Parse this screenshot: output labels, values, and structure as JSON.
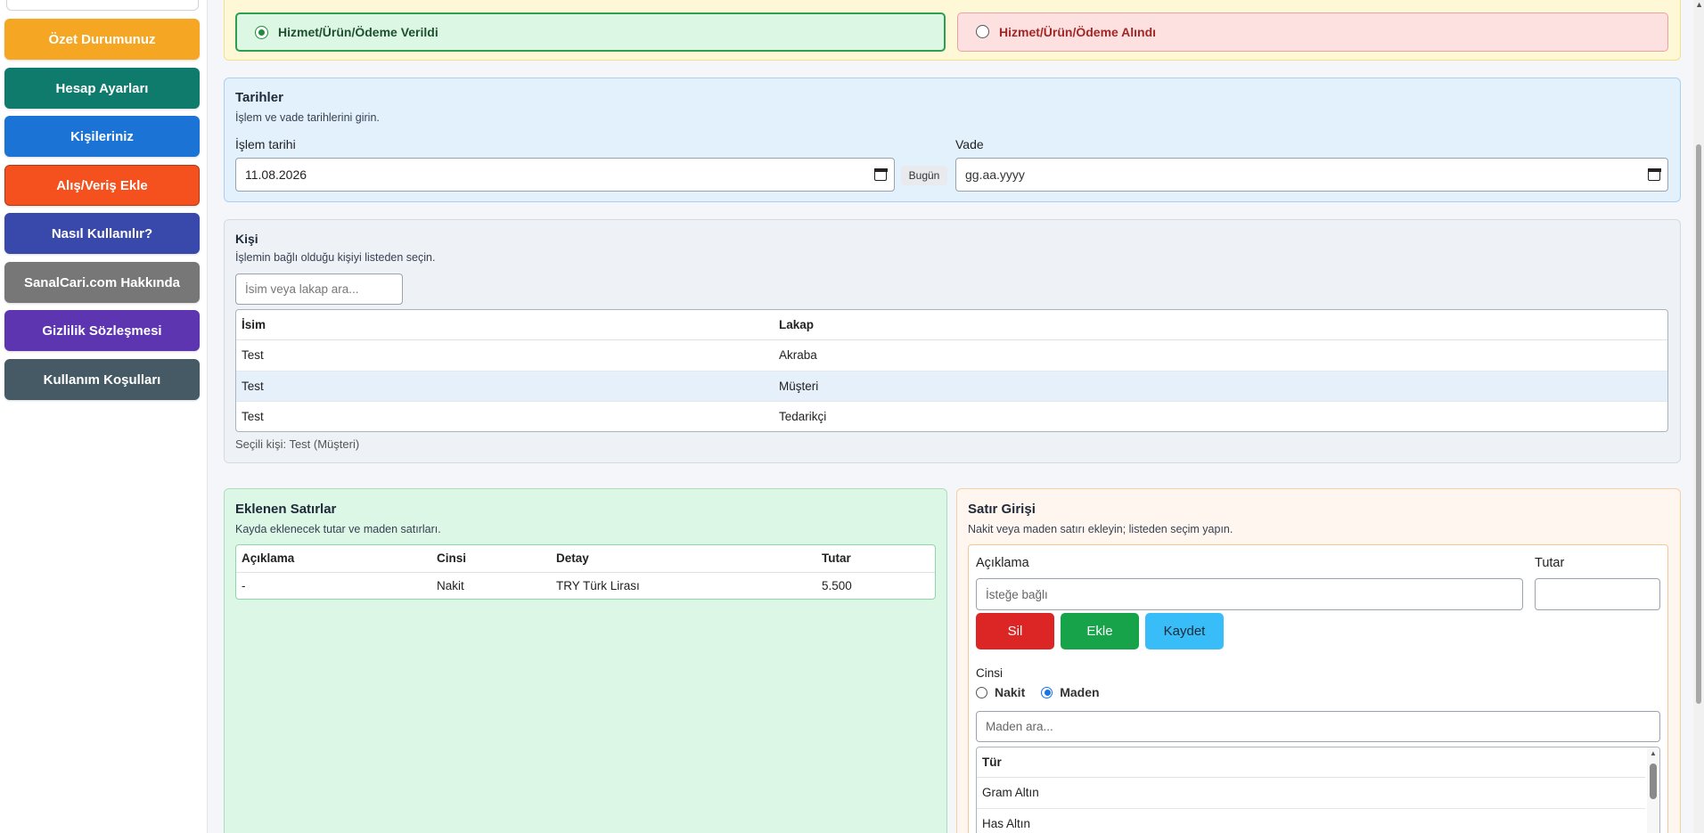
{
  "sidebar": {
    "buttons": [
      {
        "label": "Özet Durumunuz",
        "color": "#f5a623"
      },
      {
        "label": "Hesap Ayarları",
        "color": "#0f7b6c"
      },
      {
        "label": "Kişileriniz",
        "color": "#1c73d6"
      },
      {
        "label": "Alış/Veriş Ekle",
        "color": "#f4511e"
      },
      {
        "label": "Nasıl Kullanılır?",
        "color": "#3949ab"
      },
      {
        "label": "SanalCari.com Hakkında",
        "color": "#777777"
      },
      {
        "label": "Gizlilik Sözleşmesi",
        "color": "#5e35b1"
      },
      {
        "label": "Kullanım Koşulları",
        "color": "#455a64"
      }
    ]
  },
  "direction": {
    "given_label": "Hizmet/Ürün/Ödeme Verildi",
    "received_label": "Hizmet/Ürün/Ödeme Alındı",
    "selected": "given"
  },
  "dates": {
    "title": "Tarihler",
    "subtitle": "İşlem ve vade tarihlerini girin.",
    "transaction_label": "İşlem tarihi",
    "transaction_value": "11.08.2026",
    "today_label": "Bugün",
    "due_label": "Vade",
    "due_placeholder": "gg.aa.yyyy"
  },
  "person": {
    "title": "Kişi",
    "subtitle": "İşlemin bağlı olduğu kişiyi listeden seçin.",
    "search_placeholder": "İsim veya lakap ara...",
    "columns": [
      "İsim",
      "Lakap"
    ],
    "rows": [
      {
        "name": "Test",
        "nickname": "Akraba"
      },
      {
        "name": "Test",
        "nickname": "Müşteri"
      },
      {
        "name": "Test",
        "nickname": "Tedarikçi"
      }
    ],
    "selected_text": "Seçili kişi: Test (Müşteri)"
  },
  "added_lines": {
    "title": "Eklenen Satırlar",
    "subtitle": "Kayda eklenecek tutar ve maden satırları.",
    "columns": [
      "Açıklama",
      "Cinsi",
      "Detay",
      "Tutar"
    ],
    "rows": [
      {
        "desc": "-",
        "type": "Nakit",
        "detail": "TRY Türk Lirası",
        "amount": "5.500"
      }
    ]
  },
  "line_entry": {
    "title": "Satır Girişi",
    "subtitle": "Nakit veya maden satırı ekleyin; listeden seçim yapın.",
    "desc_label": "Açıklama",
    "desc_placeholder": "İsteğe bağlı",
    "amount_label": "Tutar",
    "amount_value": "",
    "delete_label": "Sil",
    "add_label": "Ekle",
    "save_label": "Kaydet",
    "kind_label": "Cinsi",
    "kind_cash": "Nakit",
    "kind_metal": "Maden",
    "kind_selected": "Maden",
    "metal_search_placeholder": "Maden ara...",
    "metal_column": "Tür",
    "metals": [
      "Gram Altın",
      "Has Altın"
    ]
  }
}
